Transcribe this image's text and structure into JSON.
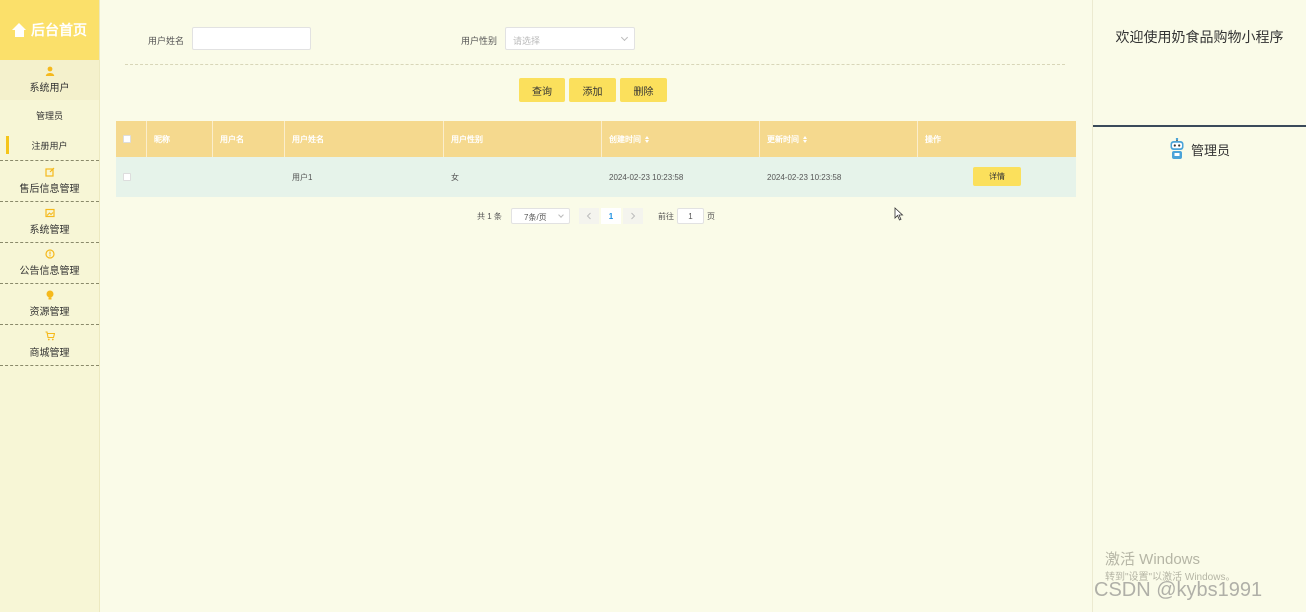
{
  "sidebar": {
    "title": "后台首页",
    "groups": [
      {
        "label": "系统用户",
        "sub": [
          "管理员",
          "注册用户"
        ]
      },
      {
        "label": "售后信息管理"
      },
      {
        "label": "系统管理"
      },
      {
        "label": "公告信息管理"
      },
      {
        "label": "资源管理"
      },
      {
        "label": "商城管理"
      }
    ]
  },
  "search": {
    "name_label": "用户姓名",
    "name_value": "",
    "gender_label": "用户性别",
    "gender_placeholder": "请选择"
  },
  "buttons": {
    "query": "查询",
    "add": "添加",
    "delete": "删除"
  },
  "table": {
    "columns": [
      "昵称",
      "用户名",
      "用户姓名",
      "用户性别",
      "创建时间",
      "更新时间",
      "操作"
    ],
    "rows": [
      {
        "nickname": "",
        "username": "",
        "name": "用户1",
        "gender": "女",
        "created": "2024-02-23 10:23:58",
        "updated": "2024-02-23 10:23:58",
        "action": "详情"
      }
    ]
  },
  "pager": {
    "total": "共 1 条",
    "size": "7条/页",
    "current": "1",
    "goto": "前往",
    "goto_value": "1",
    "page": "页"
  },
  "right": {
    "welcome": "欢迎使用奶食品购物小程序",
    "role": "管理员"
  },
  "watermark": {
    "line1": "激活 Windows",
    "line2": "转到\"设置\"以激活 Windows。",
    "line3": "CSDN @kybs1991"
  },
  "colors": {
    "accent": "#fbe05c",
    "header": "#f5d98e",
    "row": "#e6f3ea",
    "sidebar": "#f7f6d6"
  }
}
